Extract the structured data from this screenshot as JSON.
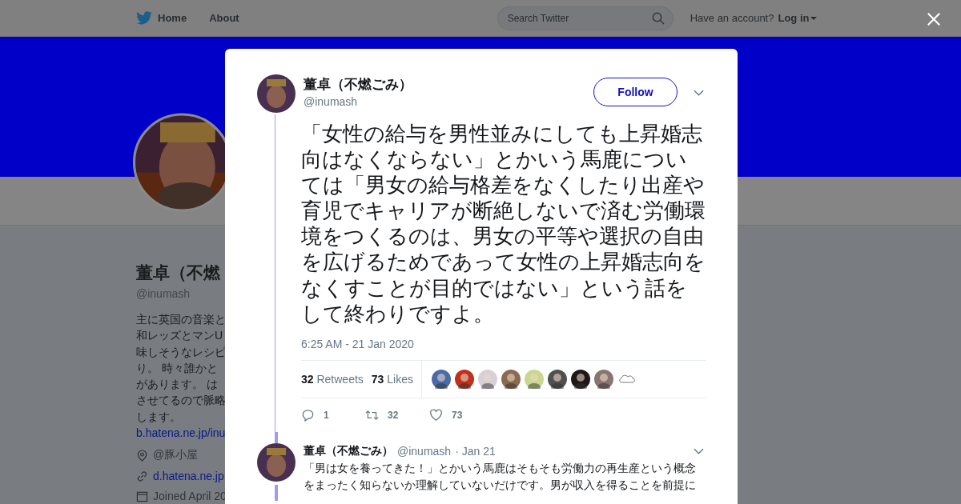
{
  "nav": {
    "home": "Home",
    "about": "About",
    "search_placeholder": "Search Twitter",
    "have_account": "Have an account?",
    "login": "Log in"
  },
  "profile": {
    "name": "董卓（不燃",
    "handle": "@inumash",
    "bio_lines": [
      "主に英国の音楽と",
      "和レッズとマンU",
      "味しそうなレシピ",
      "り。 時々誰かと",
      "があります。 は",
      "させてるので脈略",
      "します。"
    ],
    "bio_link": "b.hatena.ne.jp/inu",
    "location": "@豚小屋",
    "website": "d.hatena.ne.jp",
    "joined": "Joined April 20"
  },
  "tweet": {
    "name": "董卓（不燃ごみ）",
    "handle": "@inumash",
    "follow": "Follow",
    "text": "「女性の給与を男性並みにしても上昇婚志向はなくならない」とかいう馬鹿については「男女の給与格差をなくしたり出産や育児でキャリアが断絶しないで済む労働環境をつくるのは、男女の平等や選択の自由を広げるためであって女性の上昇婚志向をなくすことが目的ではない」という話をして終わりですよ。",
    "time": "6:25 AM - 21 Jan 2020",
    "retweets": "32",
    "retweets_label": "Retweets",
    "likes": "73",
    "likes_label": "Likes",
    "actions": [
      {
        "kind": "reply",
        "count": "1"
      },
      {
        "kind": "retweet",
        "count": "32"
      },
      {
        "kind": "like",
        "count": "73"
      }
    ]
  },
  "reply": {
    "name": "董卓（不燃ごみ）",
    "handle": "@inumash",
    "date": "· Jan 21",
    "text": "「男は女を養ってきた！」とかいう馬鹿はそもそも労働力の再生産という概念をまったく知らないか理解していないだけです。男が収入を得ることを前提に"
  }
}
